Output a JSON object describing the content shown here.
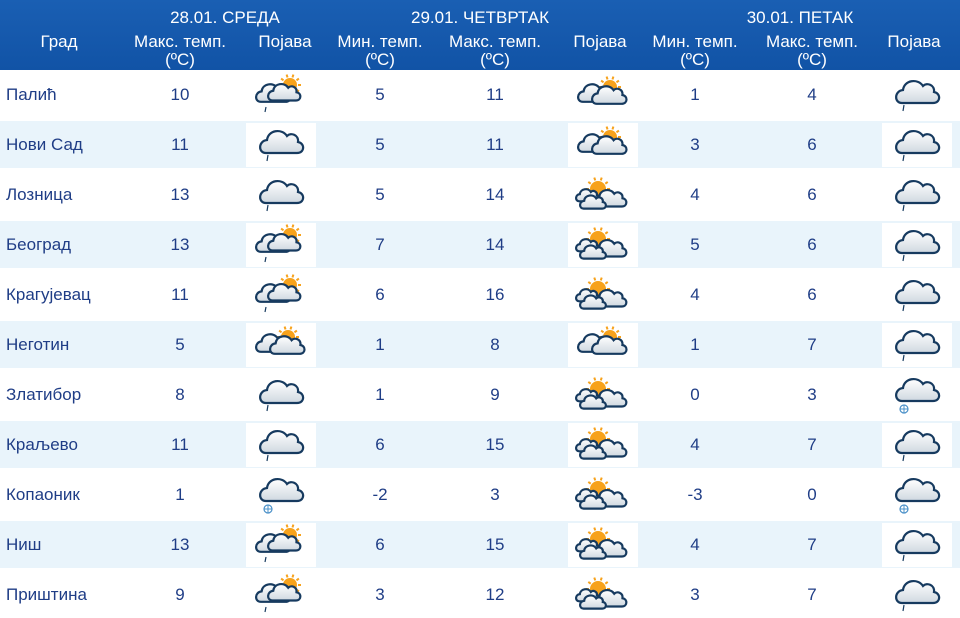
{
  "header": {
    "city_label": "Град",
    "day1": {
      "date": "28.01. СРЕДА",
      "max_label_1": "Макс. темп.",
      "unit": "(ºC)",
      "weather_label": "Појава"
    },
    "day2": {
      "date": "29.01. ЧЕТВРТАК",
      "min_label_1": "Мин. темп.",
      "max_label_1": "Макс. темп.",
      "unit": "(ºC)",
      "weather_label": "Појава"
    },
    "day3": {
      "date": "30.01. ПЕТАК",
      "min_label_1": "Мин. темп.",
      "max_label_1": "Макс. темп.",
      "unit": "(ºC)",
      "weather_label": "Појава"
    }
  },
  "rows": [
    {
      "city": "Палић",
      "d1_max": "10",
      "d1_icon": "cloudy-sun-rain-icon",
      "d2_min": "5",
      "d2_max": "11",
      "d2_icon": "cloudy-sun-icon",
      "d3_min": "1",
      "d3_max": "4",
      "d3_icon": "cloud-drizzle-icon"
    },
    {
      "city": "Нови Сад",
      "d1_max": "11",
      "d1_icon": "cloud-drizzle-icon",
      "d2_min": "5",
      "d2_max": "11",
      "d2_icon": "cloudy-sun-icon",
      "d3_min": "3",
      "d3_max": "6",
      "d3_icon": "cloud-drizzle-icon"
    },
    {
      "city": "Лозница",
      "d1_max": "13",
      "d1_icon": "cloud-drizzle-icon",
      "d2_min": "5",
      "d2_max": "14",
      "d2_icon": "partly-sunny-icon",
      "d3_min": "4",
      "d3_max": "6",
      "d3_icon": "cloud-drizzle-icon"
    },
    {
      "city": "Београд",
      "d1_max": "13",
      "d1_icon": "cloudy-sun-rain-icon",
      "d2_min": "7",
      "d2_max": "14",
      "d2_icon": "partly-sunny-icon",
      "d3_min": "5",
      "d3_max": "6",
      "d3_icon": "cloud-drizzle-icon"
    },
    {
      "city": "Крагујевац",
      "d1_max": "11",
      "d1_icon": "cloudy-sun-rain-icon",
      "d2_min": "6",
      "d2_max": "16",
      "d2_icon": "partly-sunny-icon",
      "d3_min": "4",
      "d3_max": "6",
      "d3_icon": "cloud-drizzle-icon"
    },
    {
      "city": "Неготин",
      "d1_max": "5",
      "d1_icon": "cloudy-sun-icon",
      "d2_min": "1",
      "d2_max": "8",
      "d2_icon": "cloudy-sun-icon",
      "d3_min": "1",
      "d3_max": "7",
      "d3_icon": "cloud-drizzle-icon"
    },
    {
      "city": "Златибор",
      "d1_max": "8",
      "d1_icon": "cloud-drizzle-icon",
      "d2_min": "1",
      "d2_max": "9",
      "d2_icon": "partly-sunny-icon",
      "d3_min": "0",
      "d3_max": "3",
      "d3_icon": "cloud-snow-icon"
    },
    {
      "city": "Краљево",
      "d1_max": "11",
      "d1_icon": "cloud-drizzle-icon",
      "d2_min": "6",
      "d2_max": "15",
      "d2_icon": "partly-sunny-icon",
      "d3_min": "4",
      "d3_max": "7",
      "d3_icon": "cloud-drizzle-icon"
    },
    {
      "city": "Копаоник",
      "d1_max": "1",
      "d1_icon": "cloud-snow-icon",
      "d2_min": "-2",
      "d2_max": "3",
      "d2_icon": "partly-sunny-icon",
      "d3_min": "-3",
      "d3_max": "0",
      "d3_icon": "cloud-snow-icon"
    },
    {
      "city": "Ниш",
      "d1_max": "13",
      "d1_icon": "cloudy-sun-rain-icon",
      "d2_min": "6",
      "d2_max": "15",
      "d2_icon": "partly-sunny-icon",
      "d3_min": "4",
      "d3_max": "7",
      "d3_icon": "cloud-drizzle-icon"
    },
    {
      "city": "Приштина",
      "d1_max": "9",
      "d1_icon": "cloudy-sun-rain-icon",
      "d2_min": "3",
      "d2_max": "12",
      "d2_icon": "partly-sunny-icon",
      "d3_min": "3",
      "d3_max": "7",
      "d3_icon": "cloud-drizzle-icon"
    }
  ],
  "colors": {
    "header_bg": "#1153a6",
    "header_text": "#ffffff",
    "row_alt": "#e9f4fb",
    "text": "#1f3d86",
    "sun": "#f7a21b",
    "cloud_stroke": "#163a5f"
  }
}
